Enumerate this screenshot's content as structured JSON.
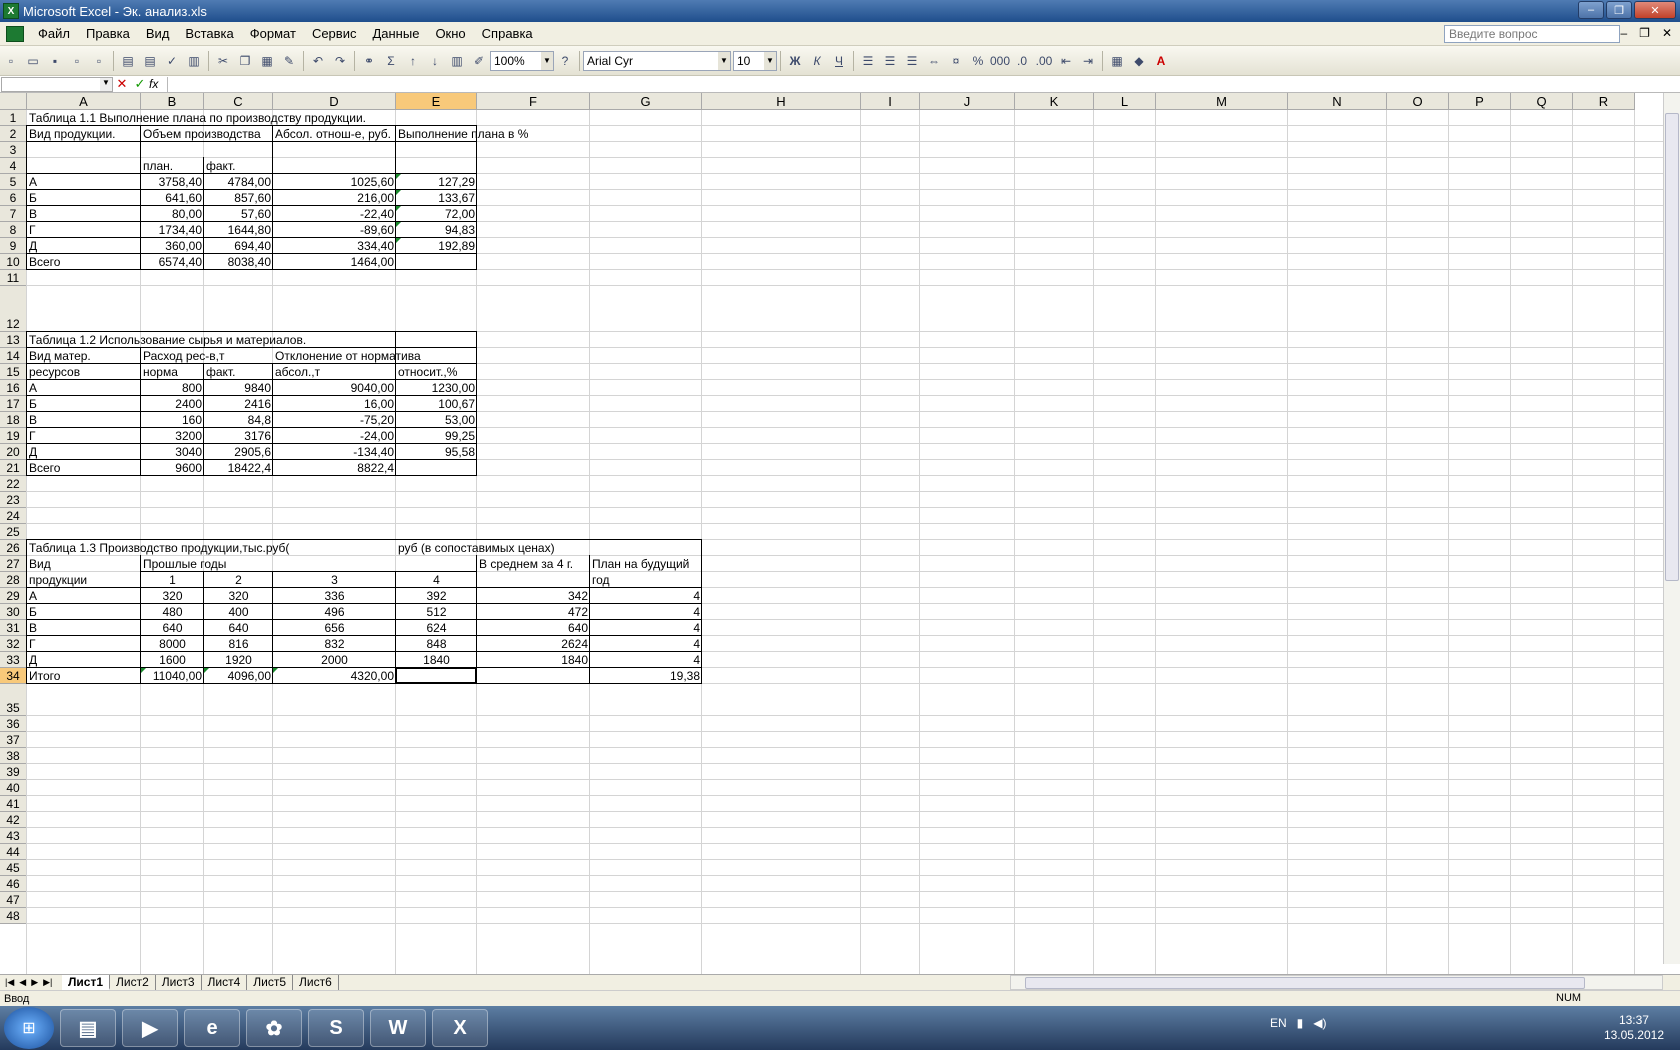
{
  "window": {
    "title": "Microsoft Excel - Эк. анализ.xls"
  },
  "menu": {
    "items": [
      "Файл",
      "Правка",
      "Вид",
      "Вставка",
      "Формат",
      "Сервис",
      "Данные",
      "Окно",
      "Справка"
    ],
    "ask_placeholder": "Введите вопрос"
  },
  "toolbar": {
    "zoom": "100%",
    "font": "Arial Cyr",
    "size": "10",
    "bold": "Ж",
    "italic": "К",
    "underline": "Ч"
  },
  "formula": {
    "cancel": "✕",
    "enter": "✓",
    "fx": "fx"
  },
  "columns": [
    "A",
    "B",
    "C",
    "D",
    "E",
    "F",
    "G",
    "H",
    "I",
    "J",
    "K",
    "L",
    "M",
    "N",
    "O",
    "P",
    "Q",
    "R"
  ],
  "rows": [
    "1",
    "2",
    "3",
    "4",
    "5",
    "6",
    "7",
    "8",
    "9",
    "10",
    "11",
    "12",
    "13",
    "14",
    "15",
    "16",
    "17",
    "18",
    "19",
    "20",
    "21",
    "22",
    "23",
    "24",
    "25",
    "26",
    "27",
    "28",
    "29",
    "30",
    "31",
    "32",
    "33",
    "34",
    "35",
    "36",
    "37",
    "38",
    "39",
    "40",
    "41",
    "42",
    "43",
    "44",
    "45",
    "46",
    "47",
    "48"
  ],
  "cells": {
    "r1": "Таблица 1.1 Выполнение плана по производству продукции.",
    "r2a": "Вид продукции.",
    "r2b": "Объем производства",
    "r2d": "Абсол. отнош-е, руб.",
    "r2e": "Выполнение плана в %",
    "r4b": "план.",
    "r4c": "факт.",
    "t1": [
      [
        "А",
        "3758,40",
        "4784,00",
        "1025,60",
        "127,29"
      ],
      [
        "Б",
        "641,60",
        "857,60",
        "216,00",
        "133,67"
      ],
      [
        "В",
        "80,00",
        "57,60",
        "-22,40",
        "72,00"
      ],
      [
        "Г",
        "1734,40",
        "1644,80",
        "-89,60",
        "94,83"
      ],
      [
        "Д",
        "360,00",
        "694,40",
        "334,40",
        "192,89"
      ],
      [
        "Всего",
        "6574,40",
        "8038,40",
        "1464,00",
        ""
      ]
    ],
    "r13": "Таблица 1.2 Использование сырья и материалов.",
    "r14a": "Вид матер.",
    "r14b": "Расход рес-в,т",
    "r14d": "Отклонение от норматива",
    "r15a": "ресурсов",
    "r15b": "норма",
    "r15c": "факт.",
    "r15d": "абсол.,т",
    "r15e": "относит.,%",
    "t2": [
      [
        "А",
        "800",
        "9840",
        "9040,00",
        "1230,00"
      ],
      [
        "Б",
        "2400",
        "2416",
        "16,00",
        "100,67"
      ],
      [
        "В",
        "160",
        "84,8",
        "-75,20",
        "53,00"
      ],
      [
        "Г",
        "3200",
        "3176",
        "-24,00",
        "99,25"
      ],
      [
        "Д",
        "3040",
        "2905,6",
        "-134,40",
        "95,58"
      ],
      [
        "Всего",
        "9600",
        "18422,4",
        "8822,4",
        ""
      ]
    ],
    "r26a": "Таблица 1.3 Производство продукции,тыс.руб(",
    "r26e": "руб (в сопоставимых ценах)",
    "r27a": "Вид",
    "r27b": "Прошлые годы",
    "r27f": "В среднем за 4 г.",
    "r27g": "План на будущий",
    "r28a": "продукции",
    "r28b": "1",
    "r28c": "2",
    "r28d": "3",
    "r28e": "4",
    "r28g": "год",
    "t3": [
      [
        "А",
        "320",
        "320",
        "336",
        "392",
        "342",
        "4"
      ],
      [
        "Б",
        "480",
        "400",
        "496",
        "512",
        "472",
        "4"
      ],
      [
        "В",
        "640",
        "640",
        "656",
        "624",
        "640",
        "4"
      ],
      [
        "Г",
        "8000",
        "816",
        "832",
        "848",
        "2624",
        "4"
      ],
      [
        "Д",
        "1600",
        "1920",
        "2000",
        "1840",
        "1840",
        "4"
      ]
    ],
    "r34": [
      "Итого",
      "11040,00",
      "4096,00",
      "4320,00",
      "",
      "",
      "19,38"
    ]
  },
  "sheets": [
    "Лист1",
    "Лист2",
    "Лист3",
    "Лист4",
    "Лист5",
    "Лист6"
  ],
  "status": {
    "mode": "Ввод",
    "num": "NUM"
  },
  "taskbar": {
    "lang": "EN",
    "time": "13:37",
    "date": "13.05.2012"
  }
}
